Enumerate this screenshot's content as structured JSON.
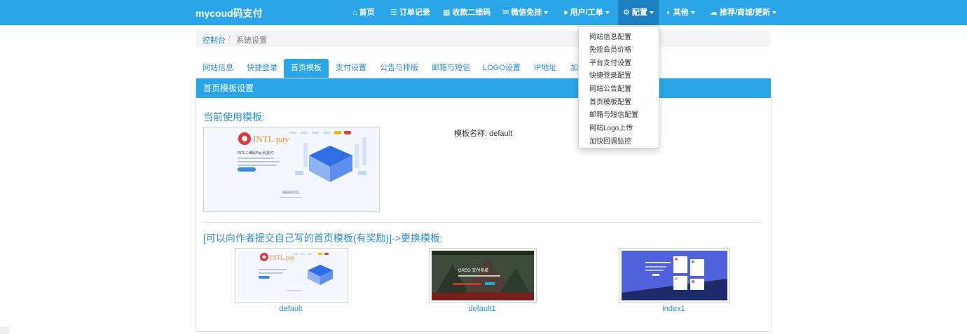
{
  "brand": "mycoud码支付",
  "nav": [
    {
      "icon": "⌂",
      "label": "首页",
      "dropdown": false
    },
    {
      "icon": "☰",
      "label": "订单记录",
      "dropdown": false
    },
    {
      "icon": "▦",
      "label": "收款二维码",
      "dropdown": false
    },
    {
      "icon": "✉",
      "label": "微信免挂",
      "dropdown": true
    },
    {
      "icon": "●",
      "label": "用户/工单",
      "dropdown": true
    },
    {
      "icon": "⚙",
      "label": "配置",
      "dropdown": true
    },
    {
      "icon": "◐",
      "label": "其他",
      "dropdown": true
    },
    {
      "icon": "☁",
      "label": "推荐/商城/更新",
      "dropdown": true
    }
  ],
  "breadcrumb": {
    "home": "控制台",
    "separator": "/",
    "current": "系统设置"
  },
  "tabs": [
    "网站信息",
    "快捷登录",
    "首页模板",
    "支付设置",
    "公告与排版",
    "邮箱与短信",
    "LOGO设置",
    "IP地址",
    "加"
  ],
  "panel_title": "首页模板设置",
  "current_heading": "当前使用模板:",
  "template_name_label": "模板名称: default",
  "submit_heading": "[可以向作者提交自己写的首页模板(有奖励)]->更换模板:",
  "templates": [
    "default",
    "default1",
    "index1"
  ],
  "thumb_text": {
    "brand": "INTL.pay",
    "headline": "INTL二维码Pay-码支付",
    "section": "便捷建设项目",
    "hero": "GREO 支付系统"
  },
  "dropdown": [
    "网站信息配置",
    "免挂会员价格",
    "平台支付设置",
    "快捷登录配置",
    "网站公告配置",
    "首页模板配置",
    "邮箱与短信配置",
    "网站Logo上传",
    "加快回调监控"
  ],
  "colors": {
    "primary": "#2aa5e8",
    "active_nav": "#1b7fc0",
    "link": "#2a8bd1"
  }
}
